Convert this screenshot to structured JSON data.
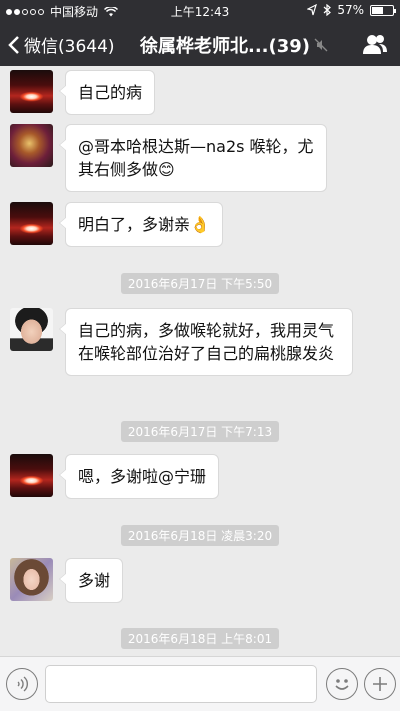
{
  "status_bar": {
    "carrier": "中国移动",
    "time": "上午12:43",
    "battery": "57%",
    "battery_level": 0.57
  },
  "nav": {
    "back_label": "微信(3644)",
    "title": "徐属桦老师北...(39)"
  },
  "messages": [
    {
      "type": "text",
      "avatar": "sun",
      "text": "自己的病"
    },
    {
      "type": "text",
      "avatar": "crystal",
      "text": "@哥本哈根达斯—na2s 喉轮，尤其右侧多做😊"
    },
    {
      "type": "text",
      "avatar": "sun",
      "text": "明白了，多谢亲👌"
    },
    {
      "type": "time",
      "text": "2016年6月17日 下午5:50"
    },
    {
      "type": "text",
      "avatar": "face",
      "text": "自己的病，多做喉轮就好，我用灵气在喉轮部位治好了自己的扁桃腺发炎"
    },
    {
      "type": "time",
      "text": "2016年6月17日 下午7:13"
    },
    {
      "type": "text",
      "avatar": "sun",
      "text": "嗯，多谢啦@宁珊"
    },
    {
      "type": "time",
      "text": "2016年6月18日 凌晨3:20"
    },
    {
      "type": "text",
      "avatar": "girl",
      "text": "多谢"
    },
    {
      "type": "time",
      "text": "2016年6月18日 上午8:01"
    }
  ],
  "input_bar": {
    "placeholder": "",
    "icons": [
      "voice-icon",
      "emoji-icon",
      "plus-icon"
    ]
  }
}
